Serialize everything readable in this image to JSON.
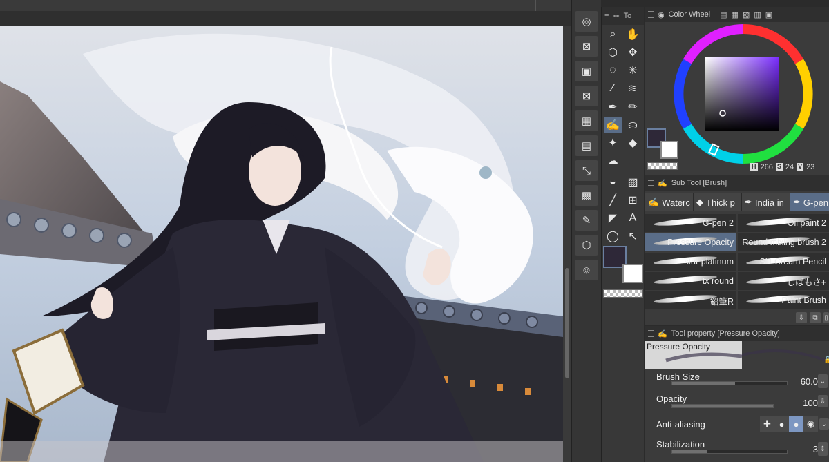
{
  "tool_palette": {
    "tab_label": "To"
  },
  "color_wheel": {
    "title": "Color Wheel",
    "h_label": "H",
    "h_value": "266",
    "s_label": "S",
    "s_value": "24",
    "v_label": "V",
    "v_value": "23",
    "main_color": "#2e2838",
    "sub_color": "#ffffff"
  },
  "sub_tool": {
    "title": "Sub Tool [Brush]",
    "tabs": [
      {
        "label": "Waterc",
        "icon": "watercolor-brush-icon"
      },
      {
        "label": "Thick p",
        "icon": "thick-paint-icon"
      },
      {
        "label": "India in",
        "icon": "india-ink-icon"
      },
      {
        "label": "G-pen",
        "icon": "g-pen-icon"
      }
    ],
    "brushes": [
      {
        "label": "G-pen 2"
      },
      {
        "label": "Oil paint 2"
      },
      {
        "label": "Pressure Opacity"
      },
      {
        "label": "Round mixing brush 2"
      },
      {
        "label": "star platinum"
      },
      {
        "label": "SU-Cream Pencil"
      },
      {
        "label": "tx round"
      },
      {
        "label": "しばもさ+"
      },
      {
        "label": "鉛筆R"
      },
      {
        "label": "Paint Brush"
      }
    ]
  },
  "tool_property": {
    "title": "Tool property [Pressure Opacity]",
    "preview_label": "Pressure Opacity",
    "brush_size_label": "Brush Size",
    "brush_size_value": "60.0",
    "brush_size_fraction": 0.55,
    "opacity_label": "Opacity",
    "opacity_value": "100",
    "opacity_fraction": 1.0,
    "anti_aliasing_label": "Anti-aliasing",
    "stabilization_label": "Stabilization",
    "stabilization_value": "3",
    "stabilization_fraction": 0.3
  }
}
